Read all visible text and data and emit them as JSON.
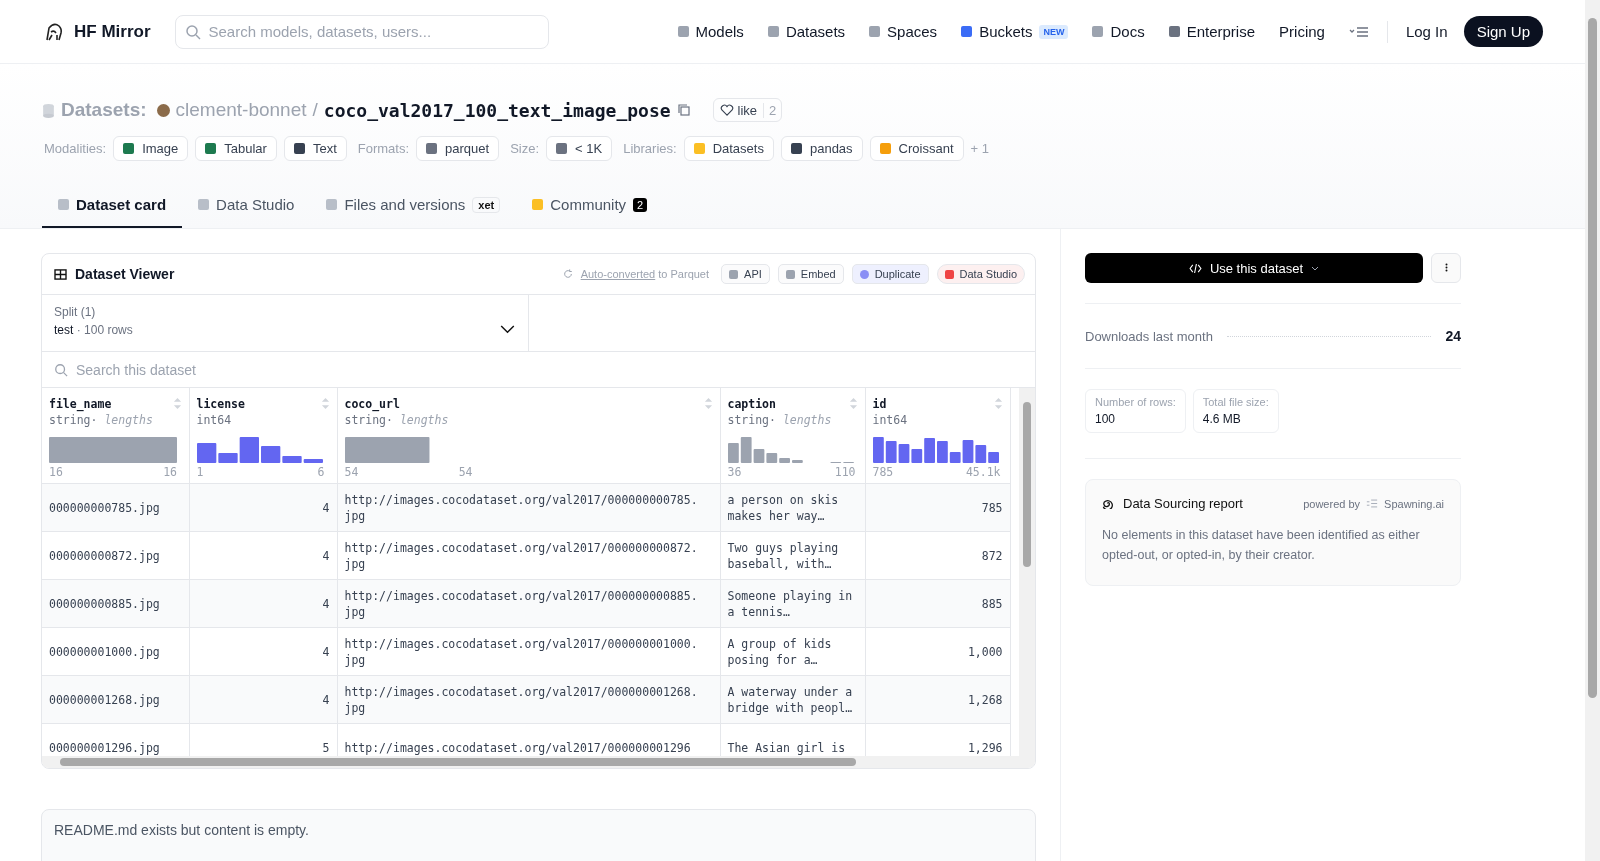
{
  "nav": {
    "brand": "HF Mirror",
    "search_placeholder": "Search models, datasets, users...",
    "links": [
      {
        "label": "Models"
      },
      {
        "label": "Datasets"
      },
      {
        "label": "Spaces"
      },
      {
        "label": "Buckets",
        "badge": "NEW"
      },
      {
        "label": "Docs"
      },
      {
        "label": "Enterprise"
      },
      {
        "label": "Pricing"
      }
    ],
    "login": "Log In",
    "signup": "Sign Up"
  },
  "header": {
    "section": "Datasets:",
    "owner": "clement-bonnet",
    "separator": "/",
    "name": "coco_val2017_100_text_image_pose",
    "like": "like",
    "likes": "2"
  },
  "tag_groups": [
    {
      "label": "Modalities:",
      "items": [
        "Image",
        "Tabular",
        "Text"
      ]
    },
    {
      "label": "Formats:",
      "items": [
        "parquet"
      ]
    },
    {
      "label": "Size:",
      "items": [
        "< 1K"
      ]
    },
    {
      "label": "Libraries:",
      "items": [
        "Datasets",
        "pandas",
        "Croissant"
      ],
      "more": "+ 1"
    }
  ],
  "tabs": [
    {
      "label": "Dataset card",
      "selected": true
    },
    {
      "label": "Data Studio",
      "selected": false
    },
    {
      "label": "Files and versions",
      "badge": "xet",
      "selected": false
    },
    {
      "label": "Community",
      "count": "2",
      "selected": false
    }
  ],
  "viewer": {
    "title": "Dataset Viewer",
    "auto_link": "Auto-converted",
    "auto_rest": "to Parquet",
    "buttons": [
      "API",
      "Embed",
      "Duplicate",
      "Data Studio"
    ],
    "dot": "·",
    "split_label": "Split (1)",
    "split_value": "test",
    "split_rows": "100 rows",
    "search_placeholder": "Search this dataset",
    "columns": [
      {
        "name": "file_name",
        "type": "string",
        "note": "lengths",
        "min": "16",
        "max": "16"
      },
      {
        "name": "license",
        "type": "int64",
        "min": "1",
        "max": "6"
      },
      {
        "name": "coco_url",
        "type": "string",
        "note": "lengths",
        "min": "54",
        "max": "54"
      },
      {
        "name": "caption",
        "type": "string",
        "note": "lengths",
        "min": "36",
        "max": "110"
      },
      {
        "name": "id",
        "type": "int64",
        "min": "785",
        "max": "45.1k"
      }
    ],
    "rows": [
      [
        "000000000785.jpg",
        "4",
        "http://images.cocodataset.org/val2017/000000000785.jpg",
        "a person on skis makes her way…",
        "785"
      ],
      [
        "000000000872.jpg",
        "4",
        "http://images.cocodataset.org/val2017/000000000872.jpg",
        "Two guys playing baseball, with…",
        "872"
      ],
      [
        "000000000885.jpg",
        "4",
        "http://images.cocodataset.org/val2017/000000000885.jpg",
        "Someone playing in a tennis…",
        "885"
      ],
      [
        "000000001000.jpg",
        "4",
        "http://images.cocodataset.org/val2017/000000001000.jpg",
        "A group of kids posing for a…",
        "1,000"
      ],
      [
        "000000001268.jpg",
        "4",
        "http://images.cocodataset.org/val2017/000000001268.jpg",
        "A waterway under a bridge with peopl…",
        "1,268"
      ],
      [
        "000000001296.jpg",
        "5",
        "http://images.cocodataset.org/val2017/000000001296",
        "The Asian girl is",
        "1,296"
      ]
    ]
  },
  "readme": "README.md exists but content is empty.",
  "sidebar": {
    "use_button": "Use this dataset",
    "downloads_label": "Downloads last month",
    "downloads": "24",
    "stats": [
      {
        "label": "Number of rows:",
        "value": "100"
      },
      {
        "label": "Total file size:",
        "value": "4.6 MB"
      }
    ],
    "report": {
      "title": "Data Sourcing report",
      "powered": "powered by",
      "provider": "Spawning.ai",
      "text": "No elements in this dataset have been identified as either opted-out, or opted-in, by their creator."
    }
  }
}
